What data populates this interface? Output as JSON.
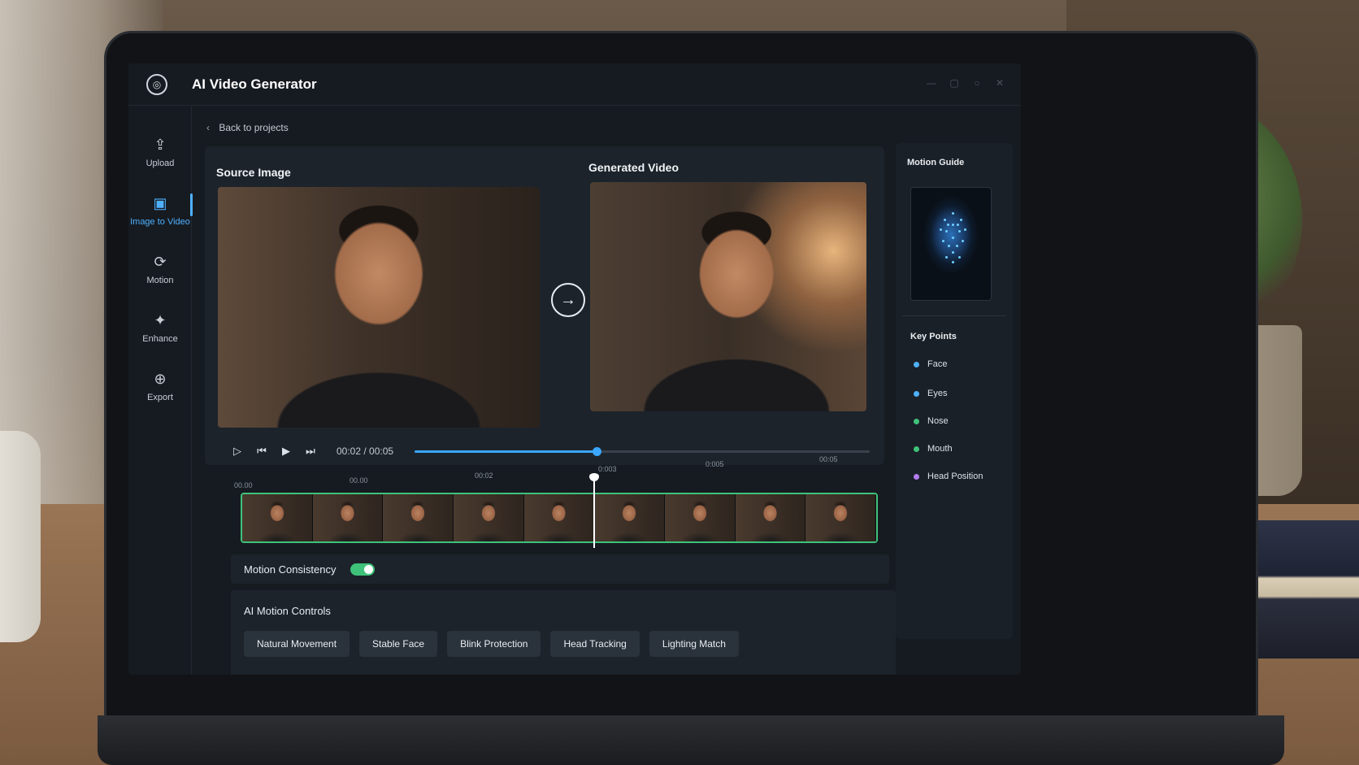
{
  "app": {
    "title": "AI Video Generator"
  },
  "sidebar": {
    "items": [
      {
        "label": "Upload",
        "icon": "upload-icon"
      },
      {
        "label": "Image to Video",
        "icon": "image-to-video-icon",
        "active": true
      },
      {
        "label": "Motion",
        "icon": "motion-icon"
      },
      {
        "label": "Enhance",
        "icon": "enhance-icon"
      },
      {
        "label": "Export",
        "icon": "export-icon"
      }
    ]
  },
  "breadcrumb": {
    "back_label": "Back to projects"
  },
  "main": {
    "source_title": "Source Image",
    "generated_title": "Generated Video"
  },
  "player": {
    "current_time": "00:02",
    "separator": " / ",
    "total_time": "00:05",
    "progress": 0.4
  },
  "timeline": {
    "ticks": [
      "00.00",
      "00.00",
      "00:02",
      "0:003",
      "0:005",
      "00:05"
    ],
    "frame_count": 9,
    "playhead_position": 0.55
  },
  "motion_consistency": {
    "label": "Motion Consistency",
    "enabled": true
  },
  "ai_motion_controls": {
    "title": "AI Motion Controls",
    "chips": [
      "Natural Movement",
      "Stable Face",
      "Blink Protection",
      "Head Tracking",
      "Lighting Match"
    ]
  },
  "right_panel": {
    "title": "Motion Guide",
    "key_points_title": "Key Points",
    "key_points": [
      {
        "label": "Face",
        "color": "#4fb0ff"
      },
      {
        "label": "Eyes",
        "color": "#4fb0ff"
      },
      {
        "label": "Nose",
        "color": "#3fc27a"
      },
      {
        "label": "Mouth",
        "color": "#3fc27a"
      },
      {
        "label": "Head Position",
        "color": "#b07cf0"
      }
    ]
  },
  "colors": {
    "accent": "#4fb0ff",
    "toggle_on": "#3fc27a",
    "timeline_border": "#3fc27a"
  }
}
